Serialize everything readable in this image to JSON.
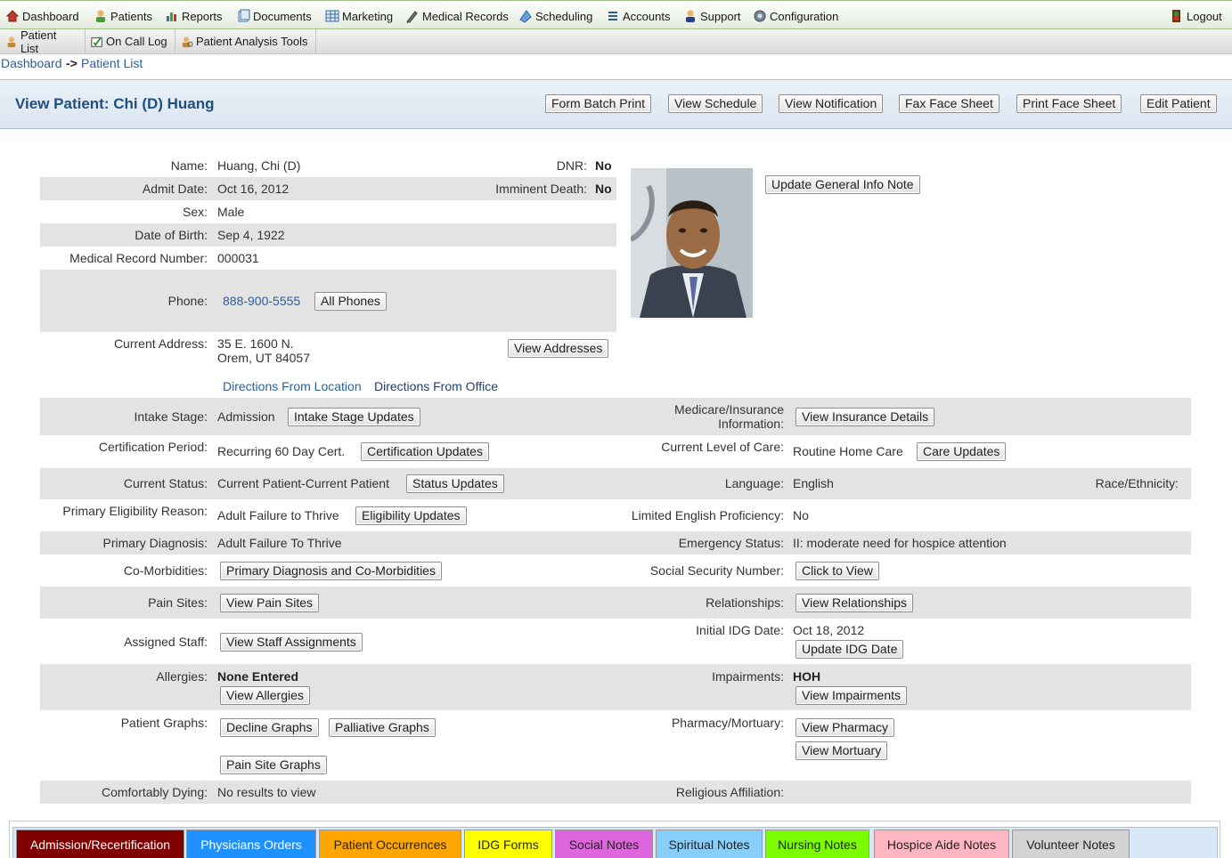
{
  "nav": {
    "items": [
      "Dashboard",
      "Patients",
      "Reports",
      "Documents",
      "Marketing",
      "Medical Records",
      "Scheduling",
      "Accounts",
      "Support",
      "Configuration"
    ],
    "logout": "Logout"
  },
  "subnav": {
    "items": [
      "Patient List",
      "On Call Log",
      "Patient Analysis Tools"
    ]
  },
  "breadcrumb": {
    "root": "Dashboard",
    "sep": "->",
    "current": "Patient List"
  },
  "header": {
    "title": "View Patient: Chi (D) Huang",
    "buttons": [
      "Form Batch Print",
      "View Schedule",
      "View Notification",
      "Fax Face Sheet",
      "Print Face Sheet",
      "Edit Patient"
    ]
  },
  "patient": {
    "name_label": "Name:",
    "name": "Huang, Chi (D)",
    "dnr_label": "DNR:",
    "dnr": "No",
    "admit_label": "Admit Date:",
    "admit": "Oct 16, 2012",
    "imminent_label": "Imminent Death:",
    "imminent": "No",
    "sex_label": "Sex:",
    "sex": "Male",
    "dob_label": "Date of Birth:",
    "dob": "Sep 4, 1922",
    "mrn_label": "Medical Record Number:",
    "mrn": "000031",
    "phone_label": "Phone:",
    "phone": "888-900-5555",
    "all_phones": "All Phones",
    "address_label": "Current Address:",
    "address1": "35 E. 1600 N.",
    "address2": "Orem, UT 84057",
    "view_addresses": "View Addresses",
    "directions_location": "Directions From Location",
    "directions_office": "Directions From Office",
    "update_note": "Update General Info Note"
  },
  "details": {
    "intake_label": "Intake Stage:",
    "intake": "Admission",
    "intake_btn": "Intake Stage Updates",
    "medicare_label1": "Medicare/Insurance",
    "medicare_label2": "Information:",
    "medicare_btn": "View Insurance Details",
    "cert_label": "Certification Period:",
    "cert": "Recurring 60 Day Cert.",
    "cert_btn": "Certification Updates",
    "loc_label": "Current Level of Care:",
    "loc": "Routine Home Care",
    "loc_btn": "Care Updates",
    "status_label": "Current Status:",
    "status": "Current Patient-Current Patient",
    "status_btn": "Status Updates",
    "language_label": "Language:",
    "language": "English",
    "race_label": "Race/Ethnicity:",
    "elig_label": "Primary Eligibility Reason:",
    "elig": "Adult Failure to Thrive",
    "elig_btn": "Eligibility Updates",
    "lep_label": "Limited English Proficiency:",
    "lep": "No",
    "diag_label": "Primary Diagnosis:",
    "diag": "Adult Failure To Thrive",
    "emerg_label": "Emergency Status:",
    "emerg": "II: moderate need for hospice attention",
    "comorb_label": "Co-Morbidities:",
    "comorb_btn": "Primary Diagnosis and Co-Morbidities",
    "ssn_label": "Social Security Number:",
    "ssn_btn": "Click to View",
    "pain_label": "Pain Sites:",
    "pain_btn": "View Pain Sites",
    "rel_label": "Relationships:",
    "rel_btn": "View Relationships",
    "staff_label": "Assigned Staff:",
    "staff_btn": "View Staff Assignments",
    "idg_label": "Initial IDG Date:",
    "idg": "Oct 18, 2012",
    "idg_btn": "Update IDG Date",
    "allergy_label": "Allergies:",
    "allergy": "None Entered",
    "allergy_btn": "View Allergies",
    "impair_label": "Impairments:",
    "impair": "HOH",
    "impair_btn": "View Impairments",
    "graphs_label": "Patient Graphs:",
    "decline_btn": "Decline Graphs",
    "palliative_btn": "Palliative Graphs",
    "painsite_btn": "Pain Site Graphs",
    "pharm_label": "Pharmacy/Mortuary:",
    "pharm_btn": "View Pharmacy",
    "mort_btn": "View Mortuary",
    "comfort_label": "Comfortably Dying:",
    "comfort": "No results to view",
    "relig_label": "Religious Affiliation:"
  },
  "tabs": [
    {
      "label": "Admission/Recertification",
      "bg": "#800000",
      "fg": "#ffffff"
    },
    {
      "label": "Physicians Orders",
      "bg": "#1e90ff",
      "fg": "#ffffff"
    },
    {
      "label": "Patient Occurrences",
      "bg": "#ffa500",
      "fg": "#222222"
    },
    {
      "label": "IDG Forms",
      "bg": "#ffff00",
      "fg": "#222222"
    },
    {
      "label": "Social Notes",
      "bg": "#dd66dd",
      "fg": "#222222"
    },
    {
      "label": "Spiritual Notes",
      "bg": "#87cefa",
      "fg": "#222222"
    },
    {
      "label": "Nursing Notes",
      "bg": "#7cfc00",
      "fg": "#222222"
    },
    {
      "label": "Hospice Aide Notes",
      "bg": "#ffb6c1",
      "fg": "#222222"
    },
    {
      "label": "Volunteer Notes",
      "bg": "#d3d3d3",
      "fg": "#222222"
    }
  ]
}
